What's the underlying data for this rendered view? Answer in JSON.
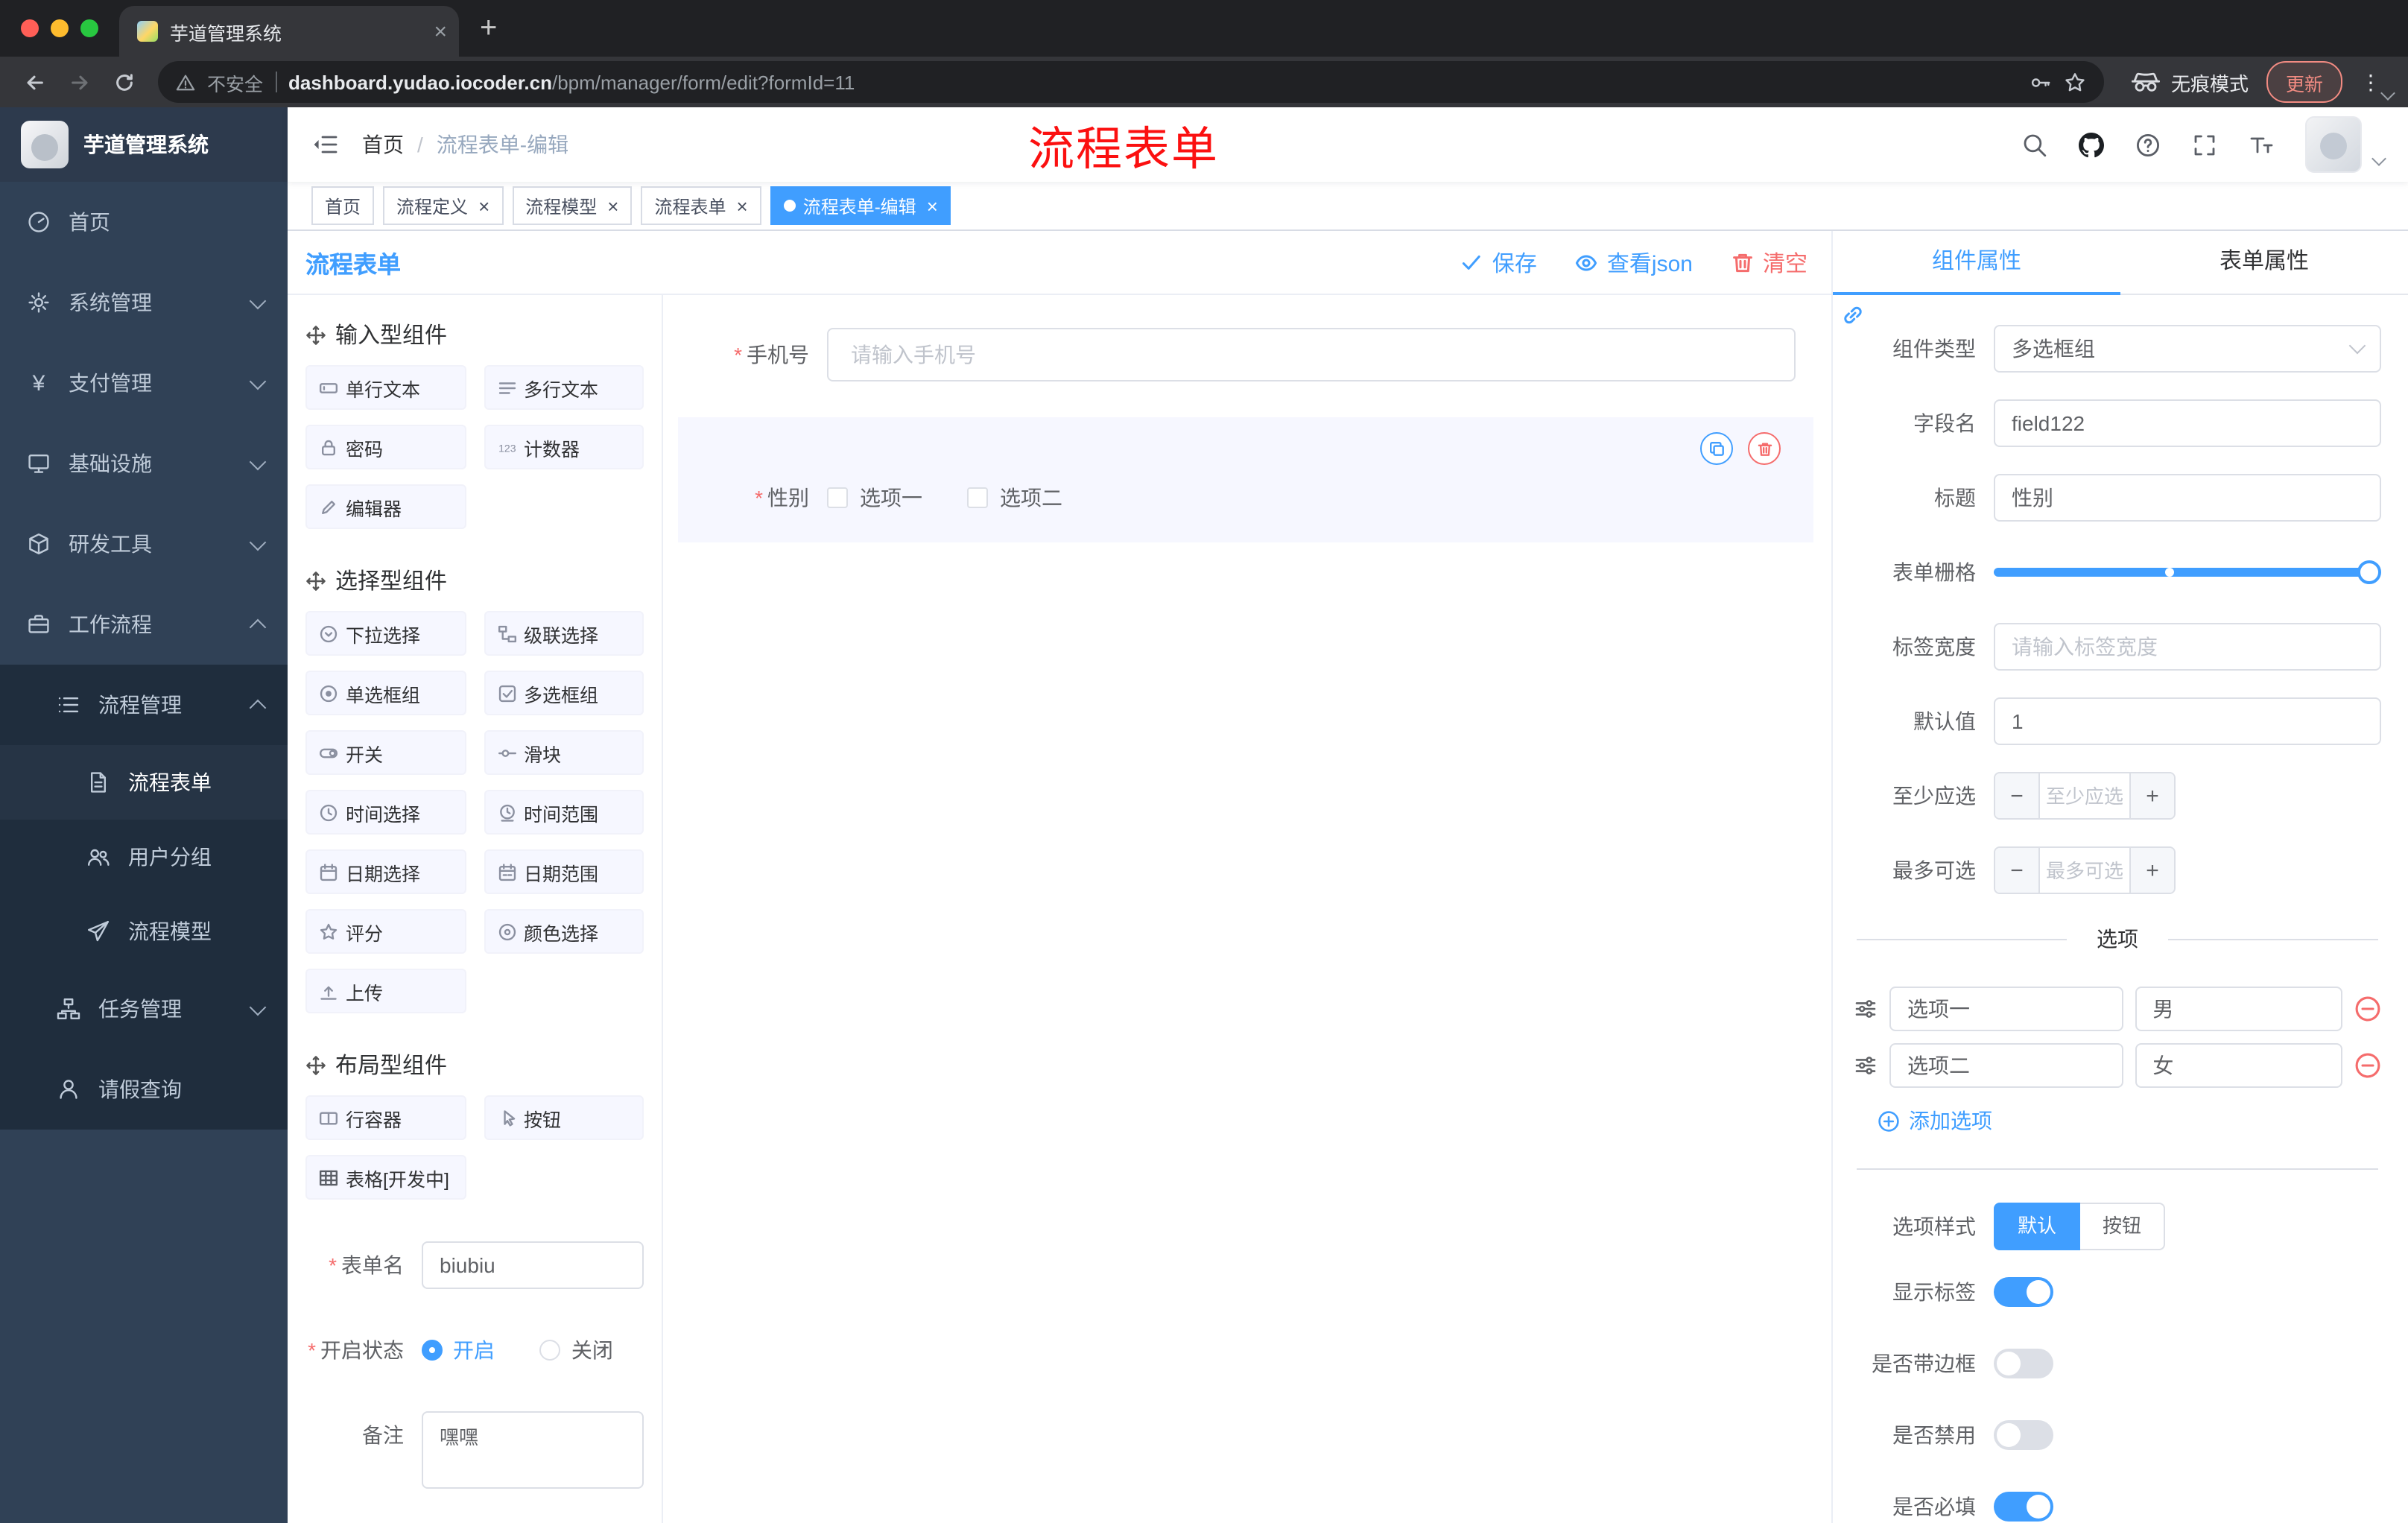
{
  "colors": {
    "accent": "#409eff",
    "danger": "#f56c6c",
    "annotation": "#fb1010",
    "sidebar_bg": "#304156",
    "submenu_bg": "#1f2d3d"
  },
  "glyphs": {
    "close": "×",
    "plus": "+",
    "kebab": "⋮",
    "minus": "−"
  },
  "browser": {
    "tab_title": "芋道管理系统",
    "security_label": "不安全",
    "url_domain": "dashboard.yudao.iocoder.cn",
    "url_path": "/bpm/manager/form/edit?formId=11",
    "incognito_label": "无痕模式",
    "update_label": "更新"
  },
  "sidebar": {
    "logo_title": "芋道管理系统",
    "items": {
      "home": "首页",
      "system": "系统管理",
      "payment": "支付管理",
      "infra": "基础设施",
      "devtool": "研发工具",
      "workflow": "工作流程",
      "process_mgmt": "流程管理",
      "process_form": "流程表单",
      "user_group": "用户分组",
      "process_model": "流程模型",
      "task_mgmt": "任务管理",
      "leave_query": "请假查询"
    }
  },
  "header": {
    "breadcrumb_home": "首页",
    "breadcrumb_sep": "/",
    "breadcrumb_current": "流程表单-编辑",
    "annotation": "流程表单"
  },
  "tags": [
    "首页",
    "流程定义",
    "流程模型",
    "流程表单",
    "流程表单-编辑"
  ],
  "editor": {
    "title": "流程表单",
    "actions": {
      "save": "保存",
      "view_json": "查看json",
      "clear": "清空"
    },
    "palette": {
      "section1_title": "输入型组件",
      "section2_title": "选择型组件",
      "section3_title": "布局型组件",
      "items": {
        "single_text": "单行文本",
        "multi_text": "多行文本",
        "password": "密码",
        "counter": "计数器",
        "editor": "编辑器",
        "select": "下拉选择",
        "cascader": "级联选择",
        "radio_group": "单选框组",
        "checkbox_group": "多选框组",
        "switch": "开关",
        "slider": "滑块",
        "time": "时间选择",
        "time_range": "时间范围",
        "date": "日期选择",
        "date_range": "日期范围",
        "rate": "评分",
        "color": "颜色选择",
        "upload": "上传",
        "row": "行容器",
        "button": "按钮",
        "table": "表格[开发中]"
      }
    },
    "form_meta": {
      "name_label": "表单名",
      "name_value": "biubiu",
      "status_label": "开启状态",
      "status_on": "开启",
      "status_off": "关闭",
      "remark_label": "备注",
      "remark_value": "嘿嘿"
    },
    "canvas": {
      "phone_label": "手机号",
      "phone_placeholder": "请输入手机号",
      "gender_label": "性别",
      "gender_option1": "选项一",
      "gender_option2": "选项二"
    }
  },
  "props": {
    "tab_component": "组件属性",
    "tab_form": "表单属性",
    "component_type_label": "组件类型",
    "component_type_value": "多选框组",
    "field_name_label": "字段名",
    "field_name_value": "field122",
    "title_label": "标题",
    "title_value": "性别",
    "grid_label": "表单栅格",
    "label_width_label": "标签宽度",
    "label_width_placeholder": "请输入标签宽度",
    "default_label": "默认值",
    "default_value": "1",
    "min_label": "至少应选",
    "min_placeholder": "至少应选",
    "max_label": "最多可选",
    "max_placeholder": "最多可选",
    "options_title": "选项",
    "option1_label": "选项一",
    "option1_value": "男",
    "option2_label": "选项二",
    "option2_value": "女",
    "add_option": "添加选项",
    "style_label": "选项样式",
    "style_default": "默认",
    "style_button": "按钮",
    "toggle_show_label": "显示标签",
    "toggle_border": "是否带边框",
    "toggle_disabled": "是否禁用",
    "toggle_required": "是否必填"
  },
  "icons": [
    "search-icon",
    "github-icon",
    "help-icon",
    "fullscreen-icon",
    "font-size-icon",
    "hamburger-icon",
    "check-icon",
    "eye-icon",
    "trash-icon",
    "copy-icon",
    "link-icon",
    "drag-handle-icon",
    "add-circle-icon",
    "remove-circle-icon",
    "incognito-icon",
    "key-icon",
    "star-icon",
    "warning-icon",
    "chevron-down-icon",
    "chevron-up-icon"
  ]
}
